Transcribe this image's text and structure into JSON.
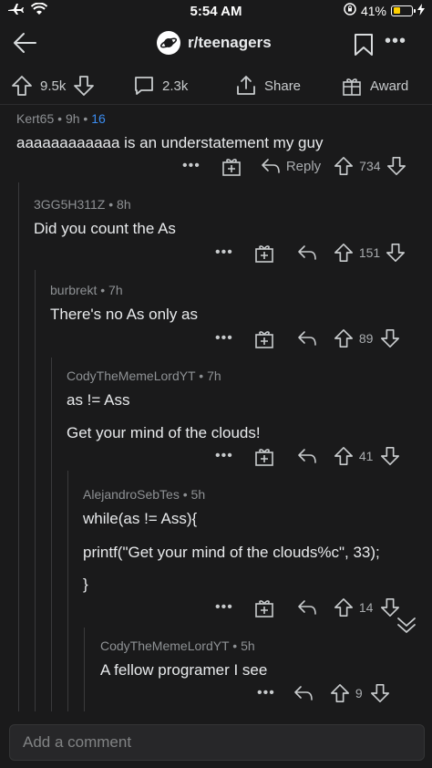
{
  "status": {
    "time": "5:54 AM",
    "battery": "41%",
    "battery_level": 0.41
  },
  "nav": {
    "subreddit": "r/teenagers"
  },
  "post_actions": {
    "upvotes": "9.5k",
    "comments": "2.3k",
    "share": "Share",
    "award": "Award"
  },
  "comments": [
    {
      "author": "Kert65",
      "age": "9h",
      "awards": "16",
      "lines": [
        "aaaaaaaaaaaa is an understatement my guy"
      ],
      "reply_label": "Reply",
      "score": "734"
    },
    {
      "author": "3GG5H311Z",
      "age": "8h",
      "lines": [
        "Did you count the As"
      ],
      "score": "151"
    },
    {
      "author": "burbrekt",
      "age": "7h",
      "lines": [
        "There's no As only as"
      ],
      "score": "89"
    },
    {
      "author": "CodyTheMemeLordYT",
      "age": "7h",
      "lines": [
        "as != Ass",
        "Get your mind of the clouds!"
      ],
      "score": "41"
    },
    {
      "author": "AlejandroSebTes",
      "age": "5h",
      "lines": [
        "while(as != Ass){",
        "printf(\"Get your mind of the clouds%c\", 33);",
        "}"
      ],
      "score": "14"
    },
    {
      "author": "CodyTheMemeLordYT",
      "age": "5h",
      "lines": [
        "A fellow programer I see"
      ],
      "score": "9"
    }
  ],
  "composer": {
    "placeholder": "Add a comment"
  }
}
